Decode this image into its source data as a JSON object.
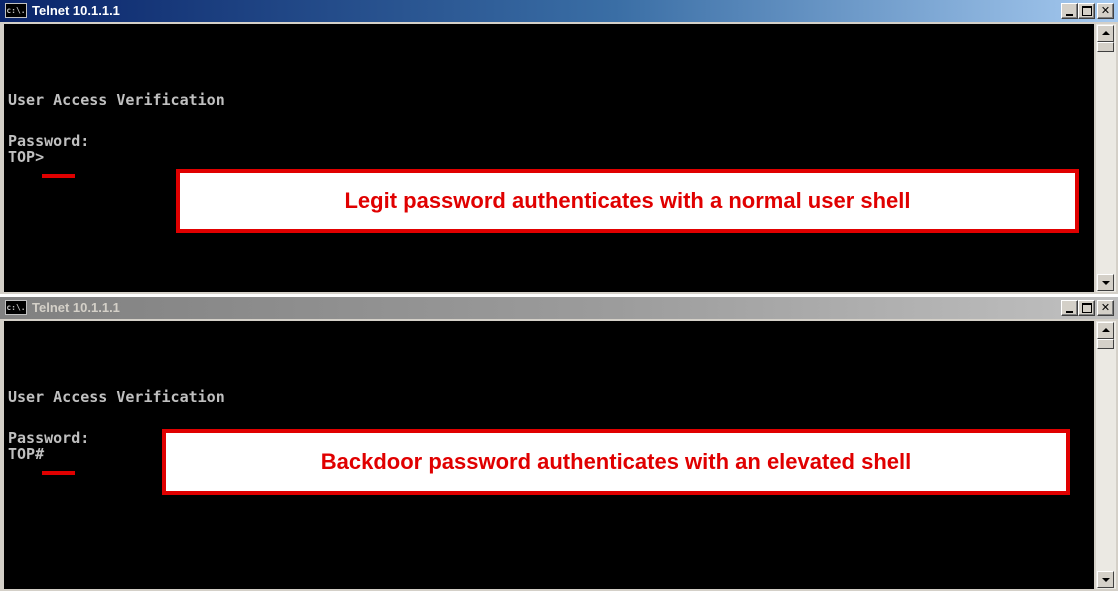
{
  "windows": [
    {
      "title": "Telnet 10.1.1.1",
      "sys_icon": "c:\\.",
      "state": "active",
      "console": {
        "heading": "User Access Verification",
        "password_prompt": "Password:",
        "prompt": "TOP>"
      },
      "annotation": "Legit password authenticates with a normal user shell"
    },
    {
      "title": "Telnet 10.1.1.1",
      "sys_icon": "c:\\.",
      "state": "inactive",
      "console": {
        "heading": "User Access Verification",
        "password_prompt": "Password:",
        "prompt": "TOP#"
      },
      "annotation": "Backdoor password authenticates with an elevated shell"
    }
  ],
  "colors": {
    "console_background": "#000000",
    "console_text": "#c0c0c0",
    "annotation_red": "#e00000",
    "active_title": "#0a246a",
    "inactive_title": "#808080"
  },
  "icons": {
    "system_menu": "console-window-icon",
    "minimize": "minimize-icon",
    "maximize": "maximize-icon",
    "close": "close-icon",
    "scroll_up": "arrow-up-icon",
    "scroll_down": "arrow-down-icon"
  }
}
